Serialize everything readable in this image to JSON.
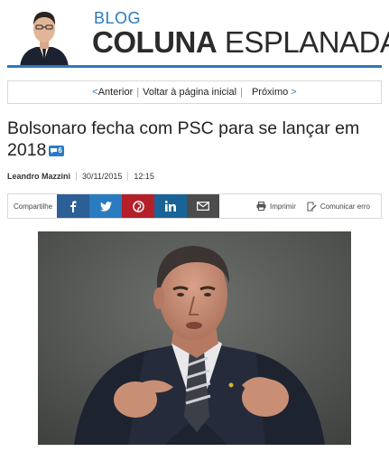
{
  "header": {
    "blog_label": "BLOG",
    "brand_bold": "COLUNA",
    "brand_light": "ESPLANADA",
    "accent": "#2a7bc0"
  },
  "nav": {
    "prev": "Anterior",
    "back": "Voltar à página inicial",
    "next": "Próximo"
  },
  "article": {
    "title": "Bolsonaro fecha com PSC para se lançar em 2018",
    "comment_count": "6",
    "author": "Leandro Mazzini",
    "date": "30/11/2015",
    "time": "12:15"
  },
  "share": {
    "label": "Compartilhe",
    "buttons": [
      "facebook-icon",
      "twitter-icon",
      "pinterest-icon",
      "linkedin-icon",
      "email-icon"
    ],
    "print_label": "Imprimir",
    "report_label": "Comunicar erro",
    "colors": {
      "facebook": "#2b5f95",
      "twitter": "#2a7bc0",
      "pinterest": "#b41f2a",
      "linkedin": "#1a6396",
      "email": "#4c4c4c"
    }
  }
}
